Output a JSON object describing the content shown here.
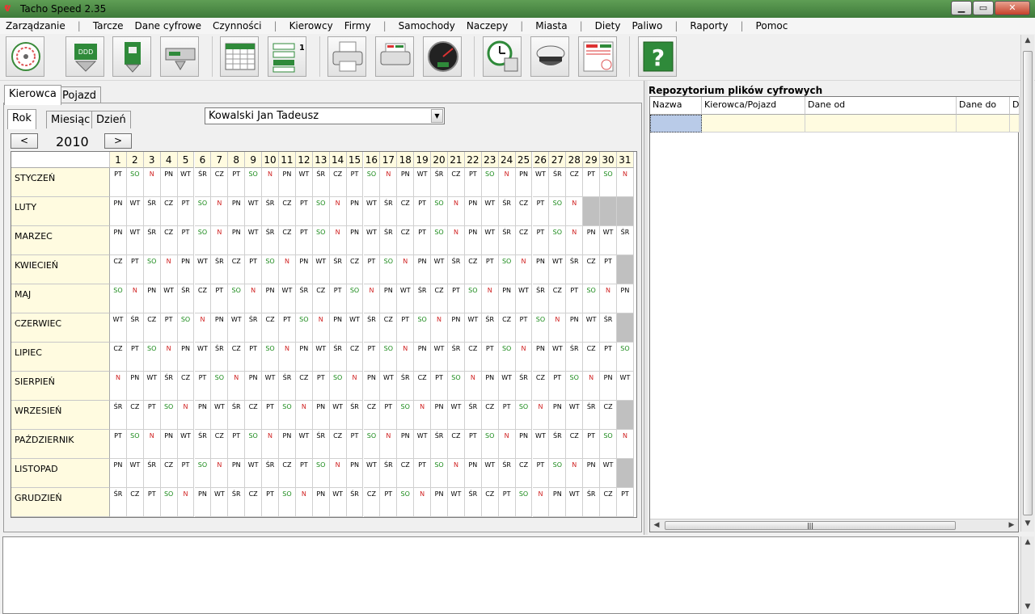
{
  "window": {
    "title": "Tacho Speed 2.35",
    "min": "▁",
    "max": "▭",
    "close": "✕"
  },
  "menu": [
    "Zarządzanie",
    "|",
    "Tarcze",
    "Dane cyfrowe",
    "Czynności",
    "|",
    "Kierowcy",
    "Firmy",
    "|",
    "Samochody",
    "Naczepy",
    "|",
    "Miasta",
    "|",
    "Diety",
    "Paliwo",
    "|",
    "Raporty",
    "|",
    "Pomoc"
  ],
  "tabs": {
    "outer": [
      "Kierowca",
      "Pojazd"
    ],
    "inner": [
      "Rok",
      "Miesiąc",
      "Dzień"
    ]
  },
  "driver": "Kowalski Jan Tadeusz",
  "nav": {
    "prev": "<",
    "next": ">",
    "year": "2010"
  },
  "colors": {
    "saturday": "#1a8a1a",
    "sunday": "#d02020",
    "label_bg": "#fffbe0"
  },
  "calendar": {
    "days": [
      "1",
      "2",
      "3",
      "4",
      "5",
      "6",
      "7",
      "8",
      "9",
      "10",
      "11",
      "12",
      "13",
      "14",
      "15",
      "16",
      "17",
      "18",
      "19",
      "20",
      "21",
      "22",
      "23",
      "24",
      "25",
      "26",
      "27",
      "28",
      "29",
      "30",
      "31"
    ],
    "months": [
      {
        "name": "STYCZEŃ",
        "days": [
          "PT",
          "SO",
          "N",
          "PN",
          "WT",
          "ŚR",
          "CZ",
          "PT",
          "SO",
          "N",
          "PN",
          "WT",
          "ŚR",
          "CZ",
          "PT",
          "SO",
          "N",
          "PN",
          "WT",
          "ŚR",
          "CZ",
          "PT",
          "SO",
          "N",
          "PN",
          "WT",
          "ŚR",
          "CZ",
          "PT",
          "SO",
          "N"
        ]
      },
      {
        "name": "LUTY",
        "days": [
          "PN",
          "WT",
          "ŚR",
          "CZ",
          "PT",
          "SO",
          "N",
          "PN",
          "WT",
          "ŚR",
          "CZ",
          "PT",
          "SO",
          "N",
          "PN",
          "WT",
          "ŚR",
          "CZ",
          "PT",
          "SO",
          "N",
          "PN",
          "WT",
          "ŚR",
          "CZ",
          "PT",
          "SO",
          "N"
        ]
      },
      {
        "name": "MARZEC",
        "days": [
          "PN",
          "WT",
          "ŚR",
          "CZ",
          "PT",
          "SO",
          "N",
          "PN",
          "WT",
          "ŚR",
          "CZ",
          "PT",
          "SO",
          "N",
          "PN",
          "WT",
          "ŚR",
          "CZ",
          "PT",
          "SO",
          "N",
          "PN",
          "WT",
          "ŚR",
          "CZ",
          "PT",
          "SO",
          "N",
          "PN",
          "WT",
          "ŚR"
        ]
      },
      {
        "name": "KWIECIEŃ",
        "days": [
          "CZ",
          "PT",
          "SO",
          "N",
          "PN",
          "WT",
          "ŚR",
          "CZ",
          "PT",
          "SO",
          "N",
          "PN",
          "WT",
          "ŚR",
          "CZ",
          "PT",
          "SO",
          "N",
          "PN",
          "WT",
          "ŚR",
          "CZ",
          "PT",
          "SO",
          "N",
          "PN",
          "WT",
          "ŚR",
          "CZ",
          "PT"
        ]
      },
      {
        "name": "MAJ",
        "days": [
          "SO",
          "N",
          "PN",
          "WT",
          "ŚR",
          "CZ",
          "PT",
          "SO",
          "N",
          "PN",
          "WT",
          "ŚR",
          "CZ",
          "PT",
          "SO",
          "N",
          "PN",
          "WT",
          "ŚR",
          "CZ",
          "PT",
          "SO",
          "N",
          "PN",
          "WT",
          "ŚR",
          "CZ",
          "PT",
          "SO",
          "N",
          "PN"
        ]
      },
      {
        "name": "CZERWIEC",
        "days": [
          "WT",
          "ŚR",
          "CZ",
          "PT",
          "SO",
          "N",
          "PN",
          "WT",
          "ŚR",
          "CZ",
          "PT",
          "SO",
          "N",
          "PN",
          "WT",
          "ŚR",
          "CZ",
          "PT",
          "SO",
          "N",
          "PN",
          "WT",
          "ŚR",
          "CZ",
          "PT",
          "SO",
          "N",
          "PN",
          "WT",
          "ŚR"
        ]
      },
      {
        "name": "LIPIEC",
        "days": [
          "CZ",
          "PT",
          "SO",
          "N",
          "PN",
          "WT",
          "ŚR",
          "CZ",
          "PT",
          "SO",
          "N",
          "PN",
          "WT",
          "ŚR",
          "CZ",
          "PT",
          "SO",
          "N",
          "PN",
          "WT",
          "ŚR",
          "CZ",
          "PT",
          "SO",
          "N",
          "PN",
          "WT",
          "ŚR",
          "CZ",
          "PT",
          "SO"
        ]
      },
      {
        "name": "SIERPIEŃ",
        "days": [
          "N",
          "PN",
          "WT",
          "ŚR",
          "CZ",
          "PT",
          "SO",
          "N",
          "PN",
          "WT",
          "ŚR",
          "CZ",
          "PT",
          "SO",
          "N",
          "PN",
          "WT",
          "ŚR",
          "CZ",
          "PT",
          "SO",
          "N",
          "PN",
          "WT",
          "ŚR",
          "CZ",
          "PT",
          "SO",
          "N",
          "PN",
          "WT"
        ]
      },
      {
        "name": "WRZESIEŃ",
        "days": [
          "ŚR",
          "CZ",
          "PT",
          "SO",
          "N",
          "PN",
          "WT",
          "ŚR",
          "CZ",
          "PT",
          "SO",
          "N",
          "PN",
          "WT",
          "ŚR",
          "CZ",
          "PT",
          "SO",
          "N",
          "PN",
          "WT",
          "ŚR",
          "CZ",
          "PT",
          "SO",
          "N",
          "PN",
          "WT",
          "ŚR",
          "CZ"
        ]
      },
      {
        "name": "PAŹDZIERNIK",
        "days": [
          "PT",
          "SO",
          "N",
          "PN",
          "WT",
          "ŚR",
          "CZ",
          "PT",
          "SO",
          "N",
          "PN",
          "WT",
          "ŚR",
          "CZ",
          "PT",
          "SO",
          "N",
          "PN",
          "WT",
          "ŚR",
          "CZ",
          "PT",
          "SO",
          "N",
          "PN",
          "WT",
          "ŚR",
          "CZ",
          "PT",
          "SO",
          "N"
        ]
      },
      {
        "name": "LISTOPAD",
        "days": [
          "PN",
          "WT",
          "ŚR",
          "CZ",
          "PT",
          "SO",
          "N",
          "PN",
          "WT",
          "ŚR",
          "CZ",
          "PT",
          "SO",
          "N",
          "PN",
          "WT",
          "ŚR",
          "CZ",
          "PT",
          "SO",
          "N",
          "PN",
          "WT",
          "ŚR",
          "CZ",
          "PT",
          "SO",
          "N",
          "PN",
          "WT"
        ]
      },
      {
        "name": "GRUDZIEŃ",
        "days": [
          "ŚR",
          "CZ",
          "PT",
          "SO",
          "N",
          "PN",
          "WT",
          "ŚR",
          "CZ",
          "PT",
          "SO",
          "N",
          "PN",
          "WT",
          "ŚR",
          "CZ",
          "PT",
          "SO",
          "N",
          "PN",
          "WT",
          "ŚR",
          "CZ",
          "PT",
          "SO",
          "N",
          "PN",
          "WT",
          "ŚR",
          "CZ",
          "PT"
        ]
      }
    ]
  },
  "repo": {
    "title": "Repozytorium plików cyfrowych",
    "columns": [
      "Nazwa",
      "Kierowca/Pojazd",
      "Dane od",
      "Dane do",
      "D"
    ]
  },
  "toolbar_icons": [
    "disc-reader-icon",
    "ddd-download-icon",
    "card-reader-icon",
    "tachograph-download-icon",
    "schedule-grid-icon",
    "activity-list-icon",
    "printer-icon",
    "report-printer-icon",
    "speedometer-icon",
    "time-calculator-icon",
    "driver-cap-icon",
    "ddd-convert-icon",
    "help-icon"
  ]
}
